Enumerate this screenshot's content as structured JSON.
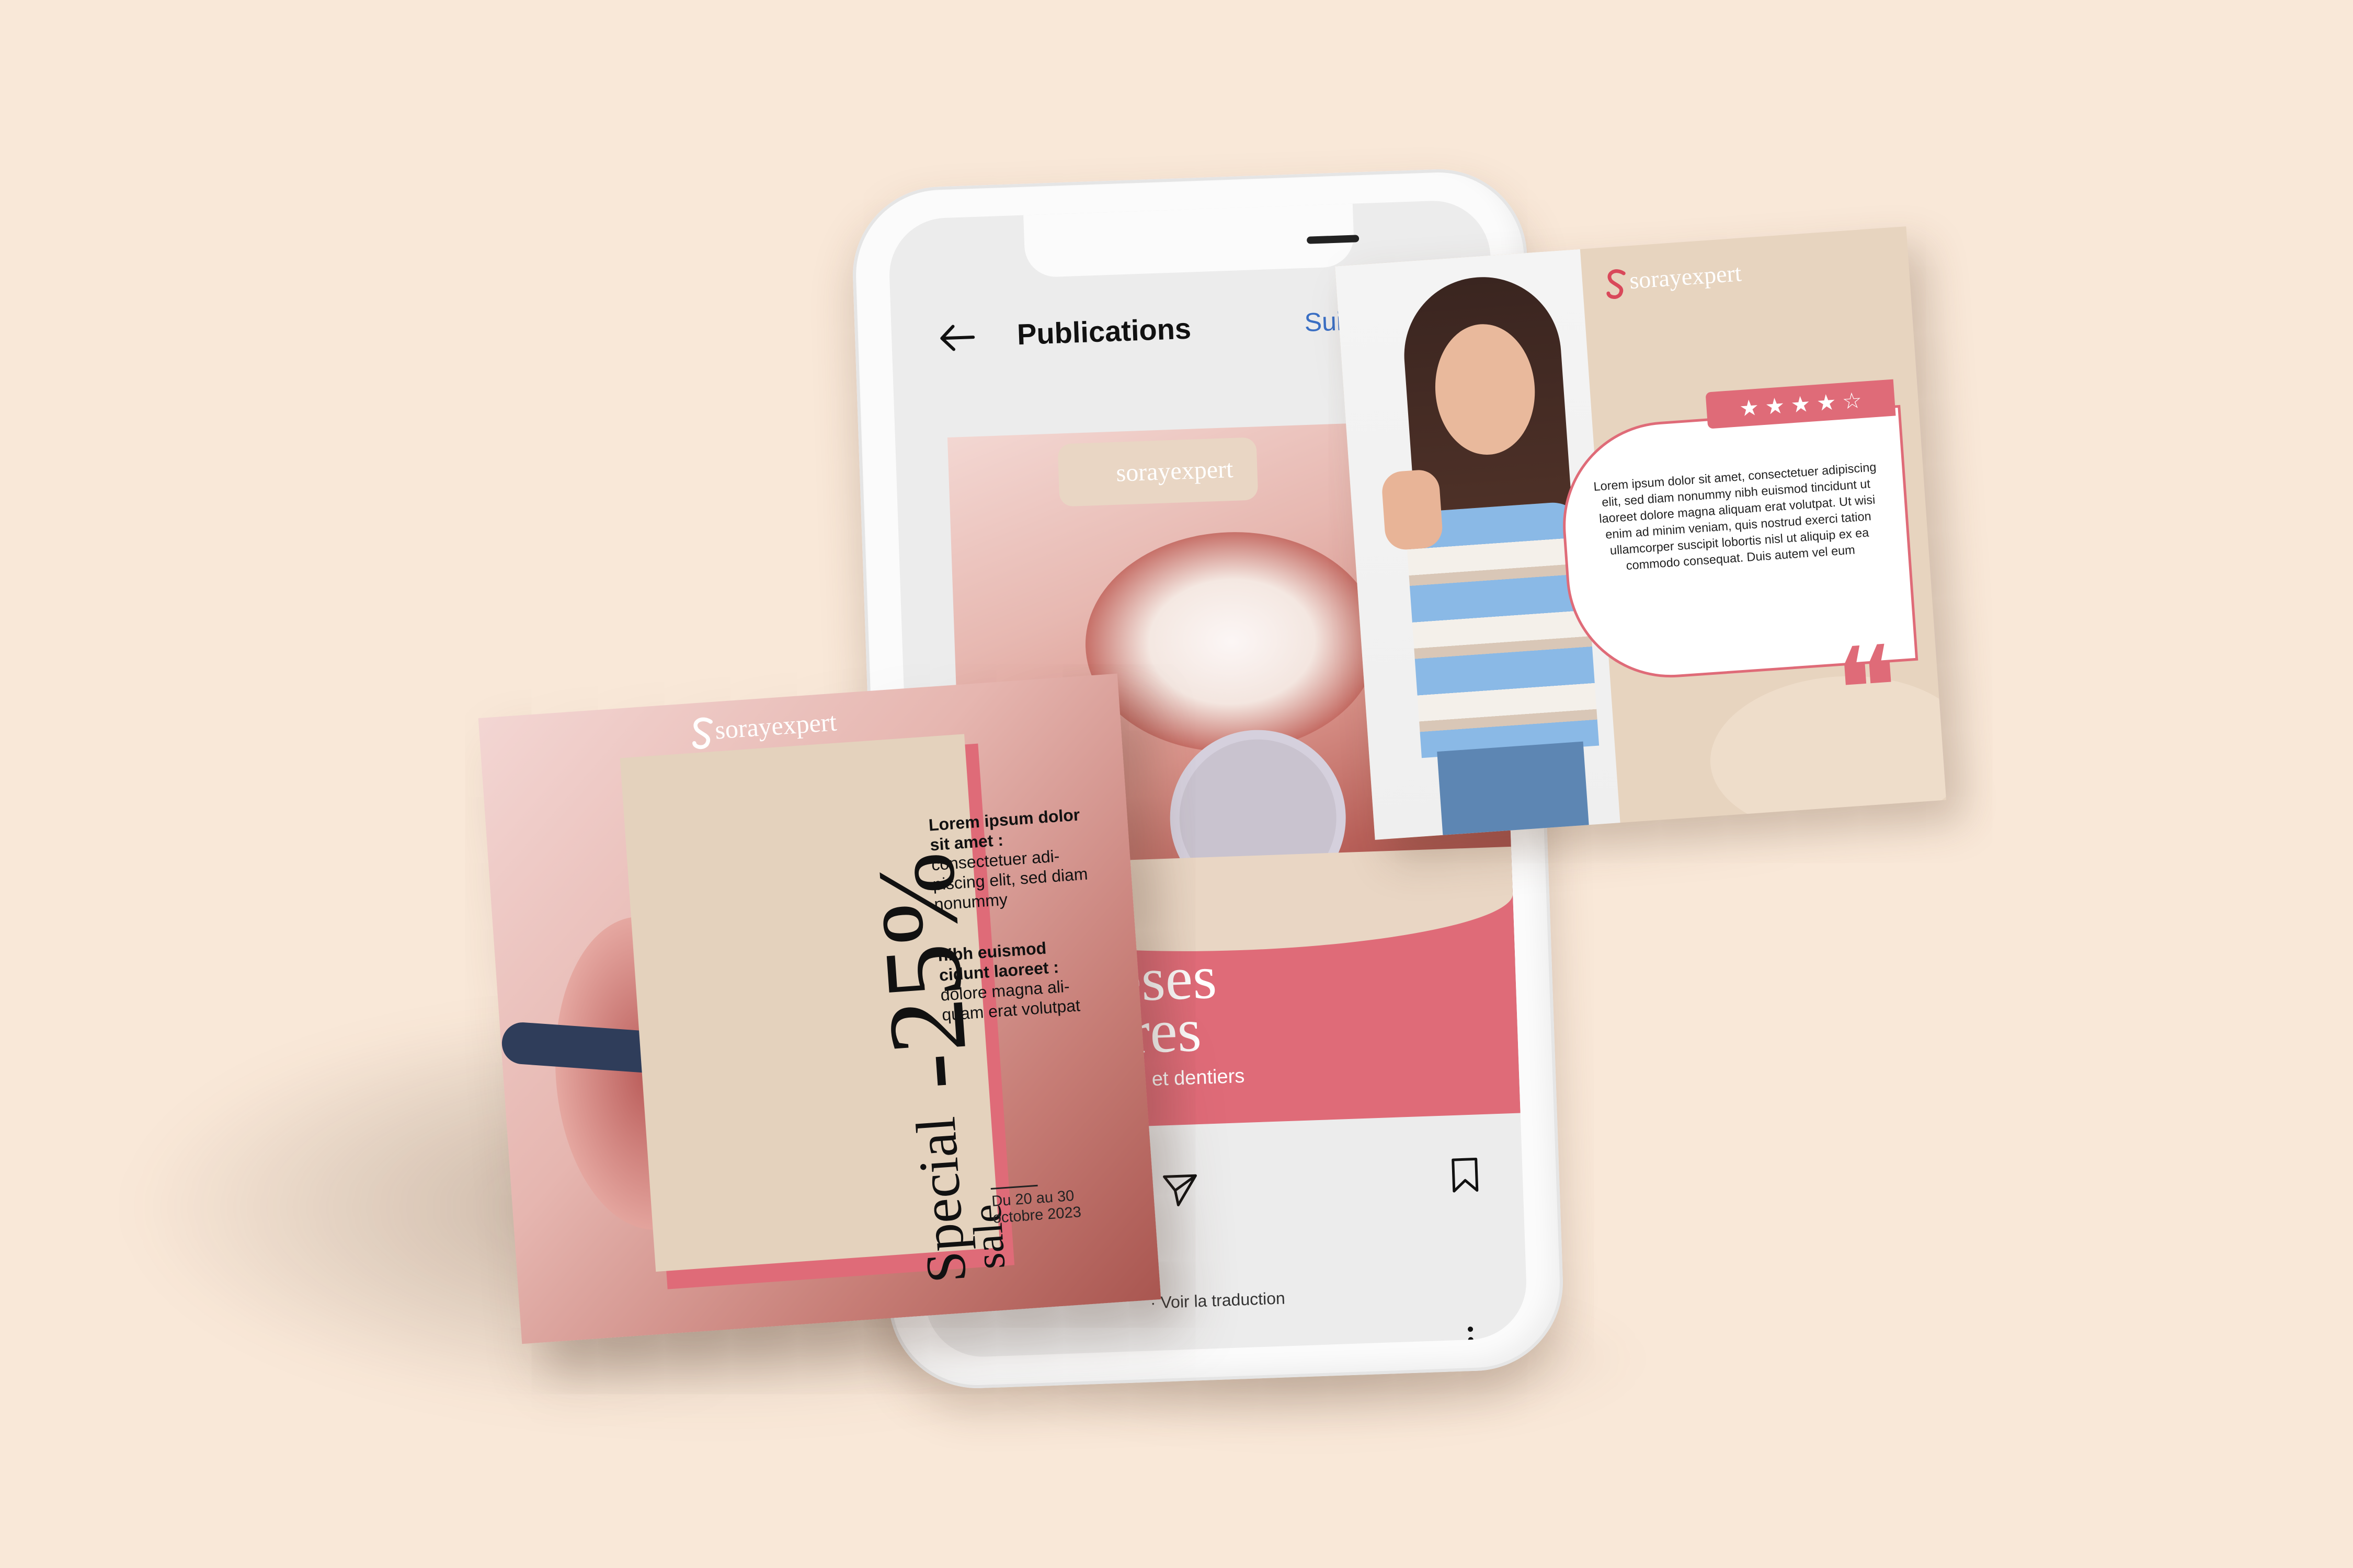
{
  "phone": {
    "header_title": "Publications",
    "follow_label": "Suivre",
    "post": {
      "logo": "sorayexpert",
      "headline_line1": "thèses",
      "headline_line2": "taires",
      "subtitle": "uronnes et dentiers"
    },
    "translate_link": "Voir la traduction"
  },
  "review_card": {
    "logo": "sorayexpert",
    "stars": "★ ★ ★ ★ ☆",
    "rating": 4,
    "text": "Lorem ipsum dolor sit amet, consectetuer adipiscing elit, sed diam nonummy nibh euismod tincidunt ut laoreet dolore magna aliquam erat volutpat. Ut wisi enim ad minim veniam, quis nostrud exerci tation ullamcorper suscipit lobortis nisl ut aliquip ex ea commodo consequat. Duis autem vel eum",
    "quote_mark": "❝"
  },
  "promo_card": {
    "logo": "sorayexpert",
    "special": "Special",
    "sale": "sale",
    "discount": "-25%",
    "block1_bold": "Lorem ipsum dolor sit amet :",
    "block1_text": "consectetuer adi-piscing elit, sed diam nonummy",
    "block2_bold": "nibh euismod cidunt laoreet :",
    "block2_text": "dolore magna ali-quam erat volutpat",
    "date": "Du 20 au 30 octobre 2023"
  },
  "colors": {
    "background": "#f9e8d8",
    "brand_pink": "#df6b78",
    "brand_beige": "#e4d2bd",
    "link_blue": "#3a6fc4"
  }
}
